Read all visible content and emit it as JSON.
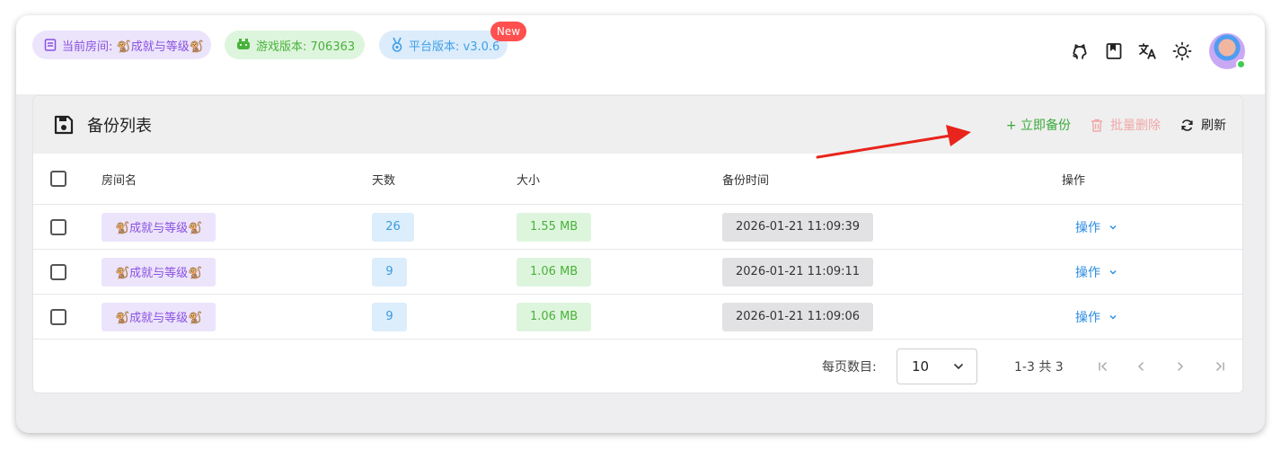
{
  "topbar": {
    "room_chip": "当前房间: 🐒成就与等级🐒",
    "game_chip": "游戏版本: 706363",
    "platform_chip": "平台版本: v3.0.6",
    "new_badge": "New",
    "icons": [
      "github-icon",
      "book-icon",
      "translate-icon",
      "theme-sun-icon"
    ]
  },
  "card": {
    "title": "备份列表",
    "actions": {
      "backup": "+  立即备份",
      "delete": "批量删除",
      "refresh": "刷新"
    }
  },
  "table": {
    "headers": {
      "room": "房间名",
      "days": "天数",
      "size": "大小",
      "time": "备份时间",
      "action": "操作"
    },
    "rows": [
      {
        "room": "🐒成就与等级🐒",
        "days": "26",
        "size": "1.55 MB",
        "time": "2026-01-21 11:09:39",
        "action": "操作"
      },
      {
        "room": "🐒成就与等级🐒",
        "days": "9",
        "size": "1.06 MB",
        "time": "2026-01-21 11:09:11",
        "action": "操作"
      },
      {
        "room": "🐒成就与等级🐒",
        "days": "9",
        "size": "1.06 MB",
        "time": "2026-01-21 11:09:06",
        "action": "操作"
      }
    ]
  },
  "pagination": {
    "per_page_label": "每页数目:",
    "per_page_value": "10",
    "range_text": "1-3 共 3"
  },
  "colors": {
    "accent_green": "#3aaa3a",
    "accent_blue": "#2b8ce0",
    "accent_purple": "#8a52e0",
    "danger": "#ff4f4f",
    "annotation_arrow": "#e8241c"
  }
}
